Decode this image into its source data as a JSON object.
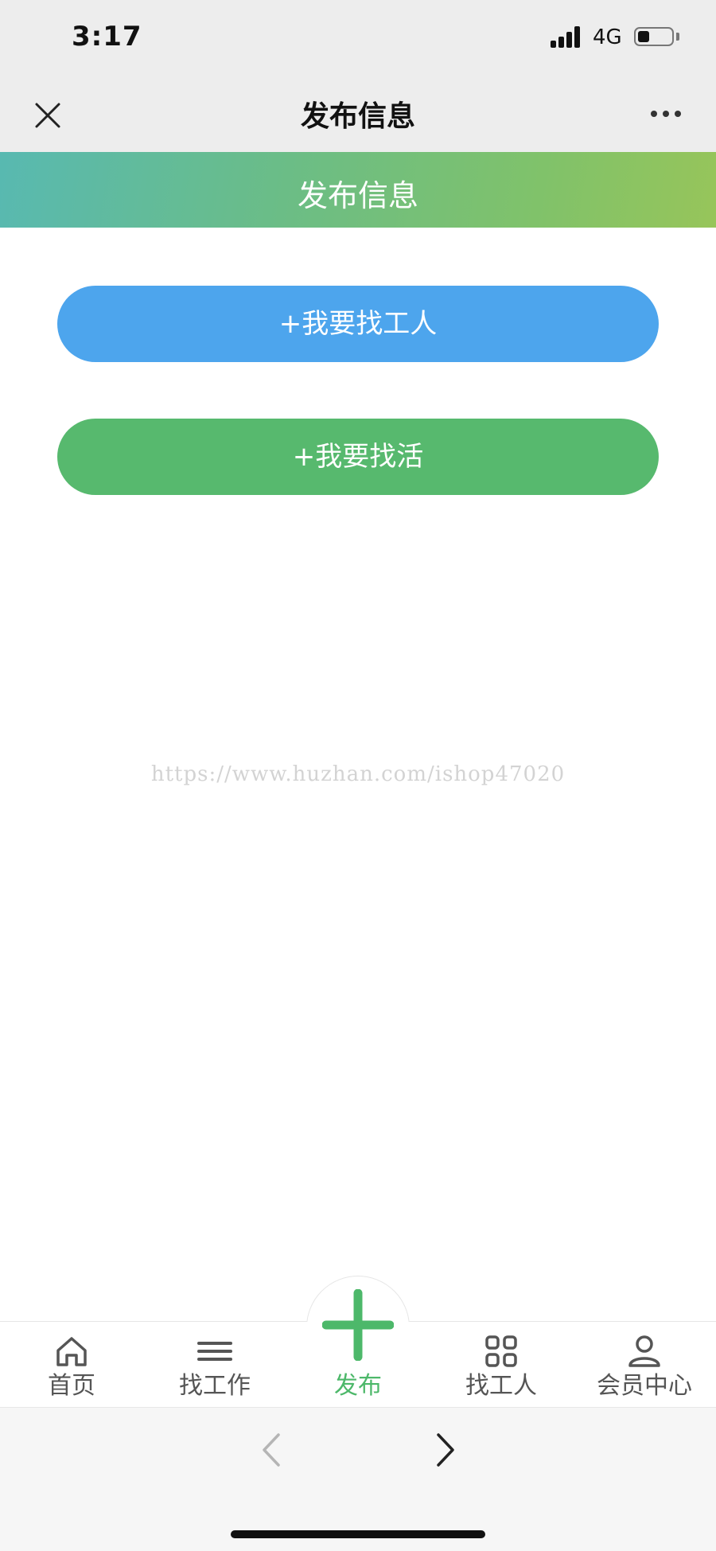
{
  "status_bar": {
    "time": "3:17",
    "network": "4G"
  },
  "nav": {
    "title": "发布信息",
    "close_icon": "close-icon",
    "more_icon": "more-icon"
  },
  "banner": {
    "title": "发布信息"
  },
  "actions": [
    {
      "label": "+我要找工人",
      "color": "#4da5ed"
    },
    {
      "label": "+我要找活",
      "color": "#57b96e"
    }
  ],
  "watermark": "https://www.huzhan.com/ishop47020",
  "tabs": [
    {
      "label": "首页",
      "icon": "home-icon",
      "active": false
    },
    {
      "label": "找工作",
      "icon": "menu-icon",
      "active": false
    },
    {
      "label": "发布",
      "icon": "plus-icon",
      "active": true
    },
    {
      "label": "找工人",
      "icon": "grid-icon",
      "active": false
    },
    {
      "label": "会员中心",
      "icon": "user-icon",
      "active": false
    }
  ],
  "browser_nav": {
    "back_icon": "chevron-left-icon",
    "forward_icon": "chevron-right-icon"
  },
  "colors": {
    "accent_green": "#57b96e",
    "accent_blue": "#4da5ed",
    "active_tab": "#4db86a"
  }
}
